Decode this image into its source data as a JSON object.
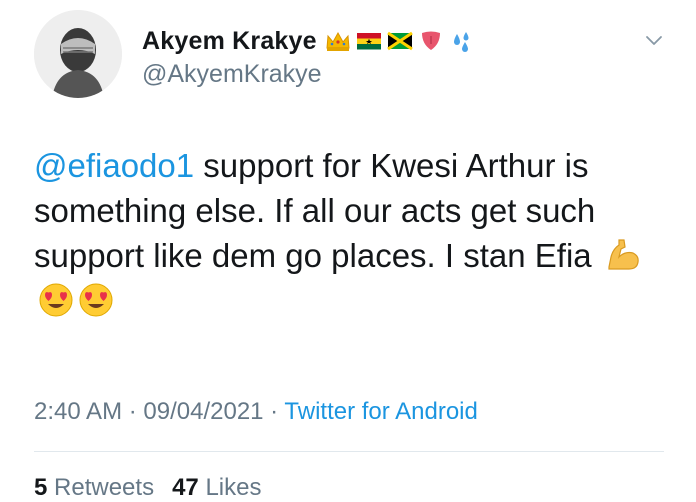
{
  "author": {
    "display_name": "Akyem Krakye",
    "handle": "@AkyemKrakye",
    "badges": [
      "crown-emoji",
      "ghana-flag",
      "jamaica-flag",
      "tongue-emoji",
      "sweat-droplets-emoji"
    ]
  },
  "tweet": {
    "mention": "@efiaodo1",
    "text": " support for Kwesi Arthur is something else. If all our acts get such support like dem go places. I stan Efia ",
    "emojis": [
      "flexed-biceps-emoji",
      "heart-eyes-emoji",
      "heart-eyes-emoji"
    ]
  },
  "meta": {
    "time": "2:40 AM",
    "separator": " · ",
    "date": "09/04/2021",
    "source": "Twitter for Android"
  },
  "stats": {
    "retweets_count": "5",
    "retweets_label": "Retweets",
    "likes_count": "47",
    "likes_label": "Likes"
  },
  "colors": {
    "link": "#1b95e0",
    "secondary_text": "#657786",
    "primary_text": "#14171a",
    "divider": "#e1e8ed"
  }
}
